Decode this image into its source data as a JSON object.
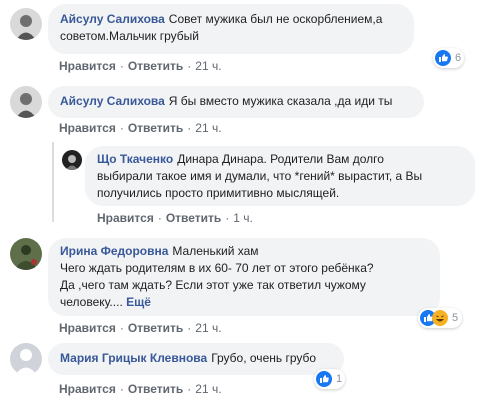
{
  "actions": {
    "like": "Нравится",
    "reply": "Ответить",
    "separator": "·"
  },
  "comments": [
    {
      "author": "Айсулу Салихова",
      "text": "Совет мужика был не оскорблением,а\nсоветом.Мальчик грубый",
      "time": "21 ч.",
      "reactions": {
        "count": "6",
        "icons": [
          "like-icon"
        ]
      }
    },
    {
      "author": "Айсулу Салихова",
      "text": "Я бы вместо мужика сказала ,да иди ты",
      "time": "21 ч."
    },
    {
      "author": "Що Ткаченко",
      "text": "Динара Динара. Родители Вам долго\nвыбирали такое имя и думали, что *гений* вырастит, а Вы\nполучились просто примитивно мыслящей.",
      "time": "1 ч."
    },
    {
      "author": "Ирина Федоровна",
      "text": "Маленький хам\nЧего ждать родителям в их 60- 70 лет от этого ребёнка?\nДа ,чего там ждать? Если этот уже так ответил чужому\nчеловеку....",
      "more": "Ещё",
      "time": "21 ч.",
      "reactions": {
        "count": "5",
        "icons": [
          "like-icon",
          "haha-icon"
        ]
      }
    },
    {
      "author": "Мария Грицык Клевнова",
      "text": "Грубо, очень грубо",
      "time": "21 ч.",
      "reactions": {
        "count": "1",
        "icons": [
          "like-icon"
        ]
      }
    }
  ]
}
